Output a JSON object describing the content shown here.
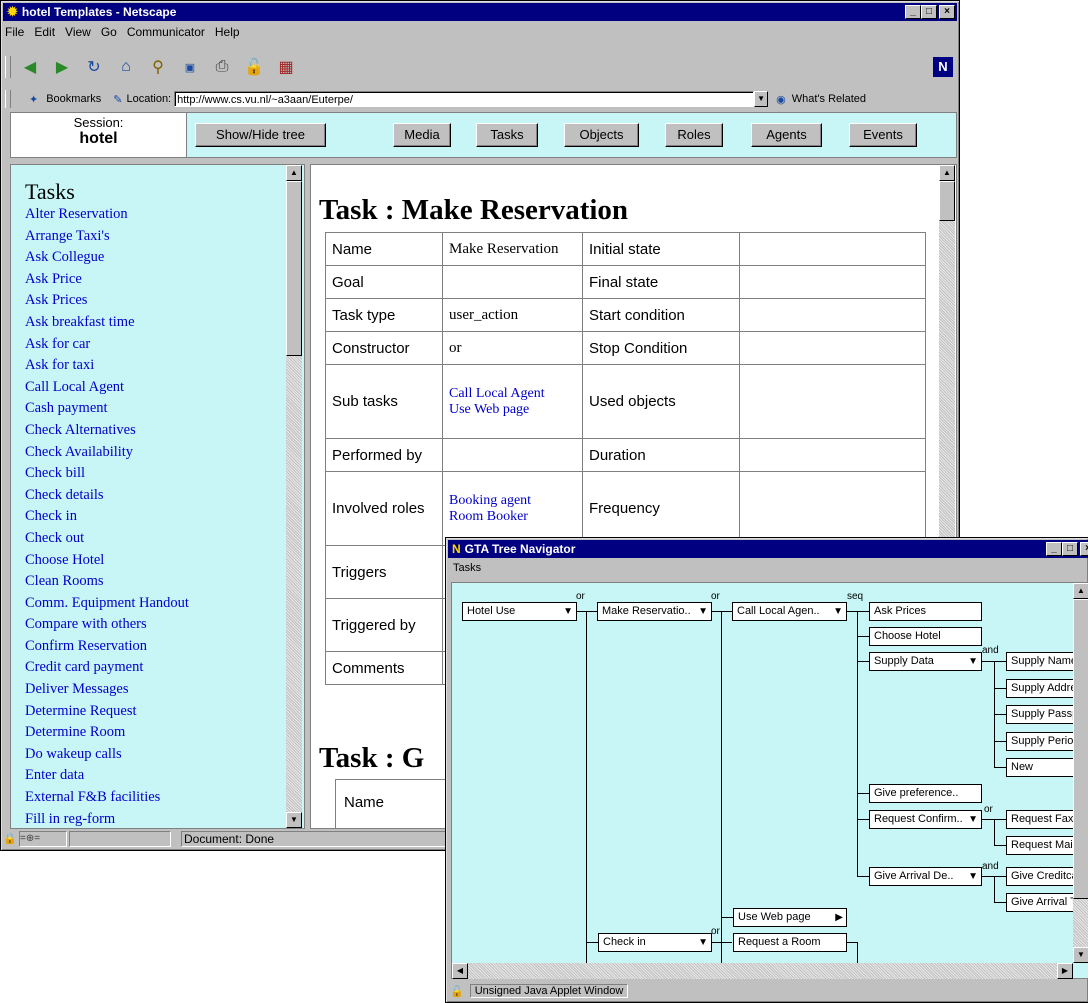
{
  "browser": {
    "title": "hotel Templates - Netscape",
    "menu": [
      "File",
      "Edit",
      "View",
      "Go",
      "Communicator",
      "Help"
    ],
    "bookmarks_label": "Bookmarks",
    "location_label": "Location:",
    "location_value": "http://www.cs.vu.nl/~a3aan/Euterpe/",
    "whats_related": "What's Related",
    "status": "Document: Done"
  },
  "session": {
    "label": "Session:",
    "value": "hotel",
    "buttons": [
      "Show/Hide tree",
      "Media",
      "Tasks",
      "Objects",
      "Roles",
      "Agents",
      "Events"
    ]
  },
  "sidebar": {
    "heading": "Tasks",
    "items": [
      "Alter Reservation",
      "Arrange Taxi's",
      "Ask Collegue",
      "Ask Price",
      "Ask Prices",
      "Ask breakfast time",
      "Ask for car",
      "Ask for taxi",
      "Call Local Agent",
      "Cash payment",
      "Check Alternatives",
      "Check Availability",
      "Check bill",
      "Check details",
      "Check in",
      "Check out",
      "Choose Hotel",
      "Clean Rooms",
      "Comm. Equipment Handout",
      "Compare with others",
      "Confirm Reservation",
      "Credit card payment",
      "Deliver Messages",
      "Determine Request",
      "Determine Room",
      "Do wakeup calls",
      "Enter data",
      "External F&B facilities",
      "Fill in reg-form"
    ]
  },
  "main": {
    "heading": "Task : Make Reservation",
    "heading2": "Task : G",
    "rows": [
      {
        "l1": "Name",
        "v1": "Make Reservation",
        "l2": "Initial state",
        "v2": ""
      },
      {
        "l1": "Goal",
        "v1": "",
        "l2": "Final state",
        "v2": ""
      },
      {
        "l1": "Task type",
        "v1": "user_action",
        "l2": "Start condition",
        "v2": ""
      },
      {
        "l1": "Constructor",
        "v1": "or",
        "l2": "Stop Condition",
        "v2": ""
      }
    ],
    "subtasks_label": "Sub tasks",
    "subtasks": [
      "Call Local Agent",
      "Use Web page"
    ],
    "used_objects_label": "Used objects",
    "performed_by_label": "Performed by",
    "duration_label": "Duration",
    "involved_roles_label": "Involved roles",
    "involved_roles": [
      "Booking agent",
      "Room Booker"
    ],
    "frequency_label": "Frequency",
    "triggers_label": "Triggers",
    "triggered_by_label": "Triggered by",
    "comments_label": "Comments",
    "name2_label": "Name"
  },
  "gta": {
    "title": "GTA Tree Navigator",
    "menu": "Tasks",
    "status": "Unsigned Java Applet Window",
    "nodes": {
      "hotel_use": "Hotel Use",
      "make_reservation": "Make Reservatio..",
      "call_local_agent": "Call Local Agen..",
      "ask_prices": "Ask Prices",
      "choose_hotel": "Choose Hotel",
      "supply_data": "Supply Data",
      "supply_name": "Supply Name",
      "supply_address": "Supply Addre",
      "supply_passport": "Supply Passp",
      "supply_period": "Supply Perioc",
      "new": "New",
      "give_preference": "Give preference..",
      "request_confirm": "Request Confirm..",
      "request_fax": "Request Fax",
      "request_mail": "Request Mail",
      "give_arrival_de": "Give Arrival De..",
      "give_creditcard": "Give Creditca",
      "give_arrival_t": "Give Arrival T",
      "use_web_page": "Use Web page",
      "check_in": "Check in",
      "request_room": "Request a Room"
    },
    "ops": {
      "or": "or",
      "seq": "seq",
      "and": "and"
    }
  }
}
